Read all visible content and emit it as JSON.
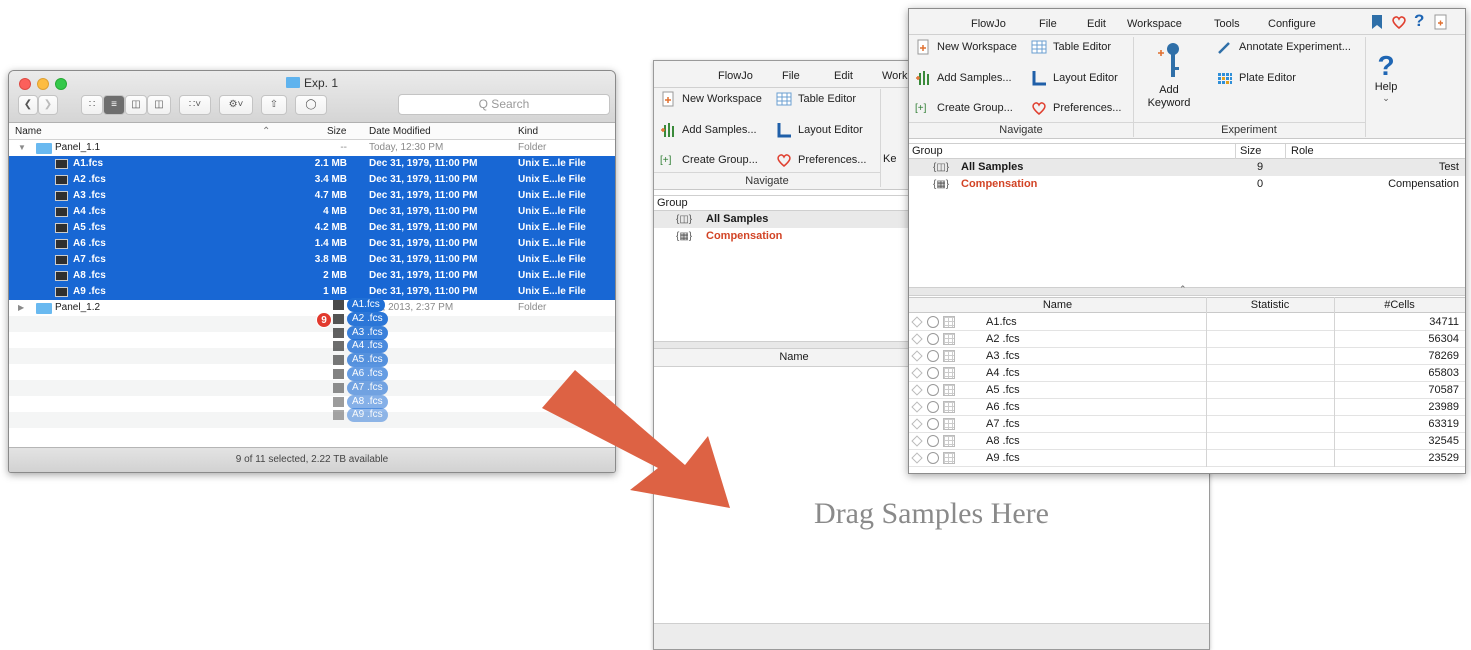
{
  "finder": {
    "title": "Exp. 1",
    "search_placeholder": "Q Search",
    "columns": {
      "name": "Name",
      "size": "Size",
      "date": "Date Modified",
      "kind": "Kind"
    },
    "folder1": {
      "name": "Panel_1.1",
      "size": "--",
      "date": "Today, 12:30 PM",
      "kind": "Folder"
    },
    "files": [
      {
        "name": "A1.fcs",
        "size": "2.1 MB",
        "date": "Dec 31, 1979, 11:00 PM",
        "kind": "Unix E...le File"
      },
      {
        "name": "A2 .fcs",
        "size": "3.4 MB",
        "date": "Dec 31, 1979, 11:00 PM",
        "kind": "Unix E...le File"
      },
      {
        "name": "A3 .fcs",
        "size": "4.7 MB",
        "date": "Dec 31, 1979, 11:00 PM",
        "kind": "Unix E...le File"
      },
      {
        "name": "A4 .fcs",
        "size": "4 MB",
        "date": "Dec 31, 1979, 11:00 PM",
        "kind": "Unix E...le File"
      },
      {
        "name": "A5 .fcs",
        "size": "4.2 MB",
        "date": "Dec 31, 1979, 11:00 PM",
        "kind": "Unix E...le File"
      },
      {
        "name": "A6 .fcs",
        "size": "1.4 MB",
        "date": "Dec 31, 1979, 11:00 PM",
        "kind": "Unix E...le File"
      },
      {
        "name": "A7 .fcs",
        "size": "3.8 MB",
        "date": "Dec 31, 1979, 11:00 PM",
        "kind": "Unix E...le File"
      },
      {
        "name": "A8 .fcs",
        "size": "2 MB",
        "date": "Dec 31, 1979, 11:00 PM",
        "kind": "Unix E...le File"
      },
      {
        "name": "A9 .fcs",
        "size": "1 MB",
        "date": "Dec 31, 1979, 11:00 PM",
        "kind": "Unix E...le File"
      }
    ],
    "folder2": {
      "name": "Panel_1.2",
      "date": "2, 2013, 2:37 PM",
      "kind": "Folder"
    },
    "drag_badge": "9",
    "drag_items": [
      "A1.fcs",
      "A2 .fcs",
      "A3 .fcs",
      "A4 .fcs",
      "A5 .fcs",
      "A6 .fcs",
      "A7 .fcs",
      "A8 .fcs",
      "A9 .fcs"
    ],
    "status": "9 of 11 selected, 2.22 TB available"
  },
  "back_window": {
    "tabs": [
      "FlowJo",
      "File",
      "Edit",
      "Work"
    ],
    "items": {
      "new_workspace": "New Workspace",
      "table_editor": "Table Editor",
      "add_samples": "Add Samples...",
      "layout_editor": "Layout Editor",
      "create_group": "Create Group...",
      "preferences": "Preferences...",
      "ke": "Ke"
    },
    "section_label": "Navigate",
    "group_header": "Group",
    "groups": [
      "All Samples",
      "Compensation"
    ],
    "name_header": "Name",
    "drag_text": "Drag Samples Here"
  },
  "front_window": {
    "tabs": [
      "FlowJo",
      "File",
      "Edit",
      "Workspace",
      "Tools",
      "Configure"
    ],
    "items": {
      "new_workspace": "New Workspace",
      "table_editor": "Table Editor",
      "add_samples": "Add Samples...",
      "layout_editor": "Layout Editor",
      "create_group": "Create Group...",
      "preferences": "Preferences...",
      "add_keyword": "Add Keyword",
      "annotate": "Annotate Experiment...",
      "plate_editor": "Plate Editor",
      "help": "Help"
    },
    "sections": {
      "navigate": "Navigate",
      "experiment": "Experiment"
    },
    "group_columns": {
      "group": "Group",
      "size": "Size",
      "role": "Role"
    },
    "groups": [
      {
        "name": "All Samples",
        "size": "9",
        "role": "Test"
      },
      {
        "name": "Compensation",
        "size": "0",
        "role": "Compensation"
      }
    ],
    "sample_columns": {
      "name": "Name",
      "statistic": "Statistic",
      "cells": "#Cells"
    },
    "samples": [
      {
        "name": "A1.fcs",
        "cells": "34711"
      },
      {
        "name": "A2 .fcs",
        "cells": "56304"
      },
      {
        "name": "A3 .fcs",
        "cells": "78269"
      },
      {
        "name": "A4 .fcs",
        "cells": "65803"
      },
      {
        "name": "A5 .fcs",
        "cells": "70587"
      },
      {
        "name": "A6 .fcs",
        "cells": "23989"
      },
      {
        "name": "A7 .fcs",
        "cells": "63319"
      },
      {
        "name": "A8 .fcs",
        "cells": "32545"
      },
      {
        "name": "A9 .fcs",
        "cells": "23529"
      }
    ]
  },
  "colors": {
    "selection": "#1867d4",
    "arrow": "#dd6244",
    "compensation": "#d24426",
    "folder": "#69b9f0"
  }
}
